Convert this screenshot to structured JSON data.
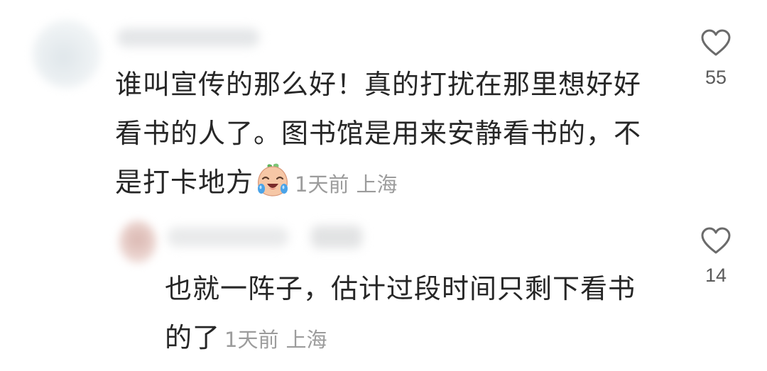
{
  "comments": [
    {
      "text_lines": [
        "谁叫宣传的那么好！真的打扰在那里想好好",
        "看书的人了。图书馆是用来安静看书的，不",
        "是打卡地方"
      ],
      "emoji": "crying-laughing-face-emoji",
      "time": "1天前",
      "location": "上海",
      "likes": "55"
    },
    {
      "text_lines": [
        "也就一阵子，估计过段时间只剩下看书",
        "的了"
      ],
      "time": "1天前",
      "location": "上海",
      "likes": "14"
    }
  ]
}
